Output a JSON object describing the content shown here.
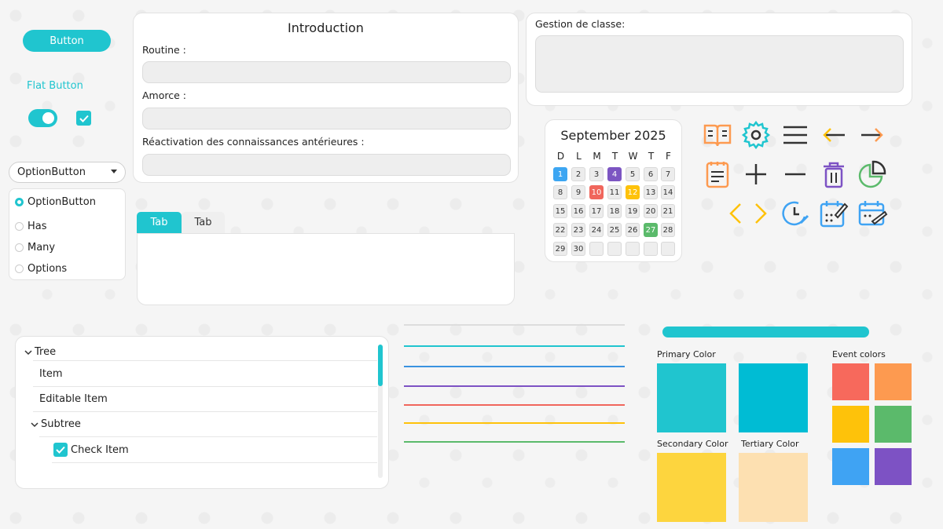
{
  "widgets": {
    "button_label": "Button",
    "flat_button_label": "Flat Button",
    "dropdown_label": "OptionButton",
    "radios": [
      "OptionButton",
      "Has",
      "Many",
      "Options"
    ]
  },
  "intro": {
    "title": "Introduction",
    "routine_label": "Routine :",
    "amorce_label": "Amorce :",
    "reactivation_label": "Réactivation des connaissances antérieures :"
  },
  "gestion": {
    "label": "Gestion de classe:"
  },
  "tabs": [
    "Tab",
    "Tab"
  ],
  "calendar": {
    "title": "September 2025",
    "weekdays": [
      "D",
      "L",
      "M",
      "T",
      "W",
      "T",
      "F"
    ],
    "days": [
      "1",
      "2",
      "3",
      "4",
      "5",
      "6",
      "7",
      "8",
      "9",
      "10",
      "11",
      "12",
      "13",
      "14",
      "15",
      "16",
      "17",
      "18",
      "19",
      "20",
      "21",
      "22",
      "23",
      "24",
      "25",
      "26",
      "27",
      "28",
      "29",
      "30"
    ]
  },
  "icons": [
    "book-icon",
    "gear-icon",
    "menu-icon",
    "arrow-left-icon",
    "arrow-right-icon",
    "notepad-icon",
    "plus-icon",
    "minus-icon",
    "trash-icon",
    "pie-chart-icon",
    "chevron-left-icon",
    "chevron-right-icon",
    "clock-edit-icon",
    "calendar-edit-icon",
    "calendar-pen-icon"
  ],
  "tree": {
    "root": "Tree",
    "item": "Item",
    "editable_item": "Editable Item",
    "subtree": "Subtree",
    "check_item": "Check Item"
  },
  "swatches": {
    "primary_label": "Primary Color",
    "secondary_label": "Secondary Color",
    "tertiary_label": "Tertiary Color",
    "event_label": "Event colors",
    "primary": "#20c5cf",
    "primary_alt": "#00bcd4",
    "secondary": "#fdd53e",
    "tertiary": "#fde0b1",
    "events": [
      "#f7695c",
      "#fd9a50",
      "#fec20a",
      "#5bba6b",
      "#3fa3f3",
      "#7d52c4"
    ]
  },
  "lines": [
    "#dddddd",
    "#20c5cf",
    "#3a92e0",
    "#7d52c4",
    "#f0665c",
    "#fec20a",
    "#5bba6b"
  ]
}
